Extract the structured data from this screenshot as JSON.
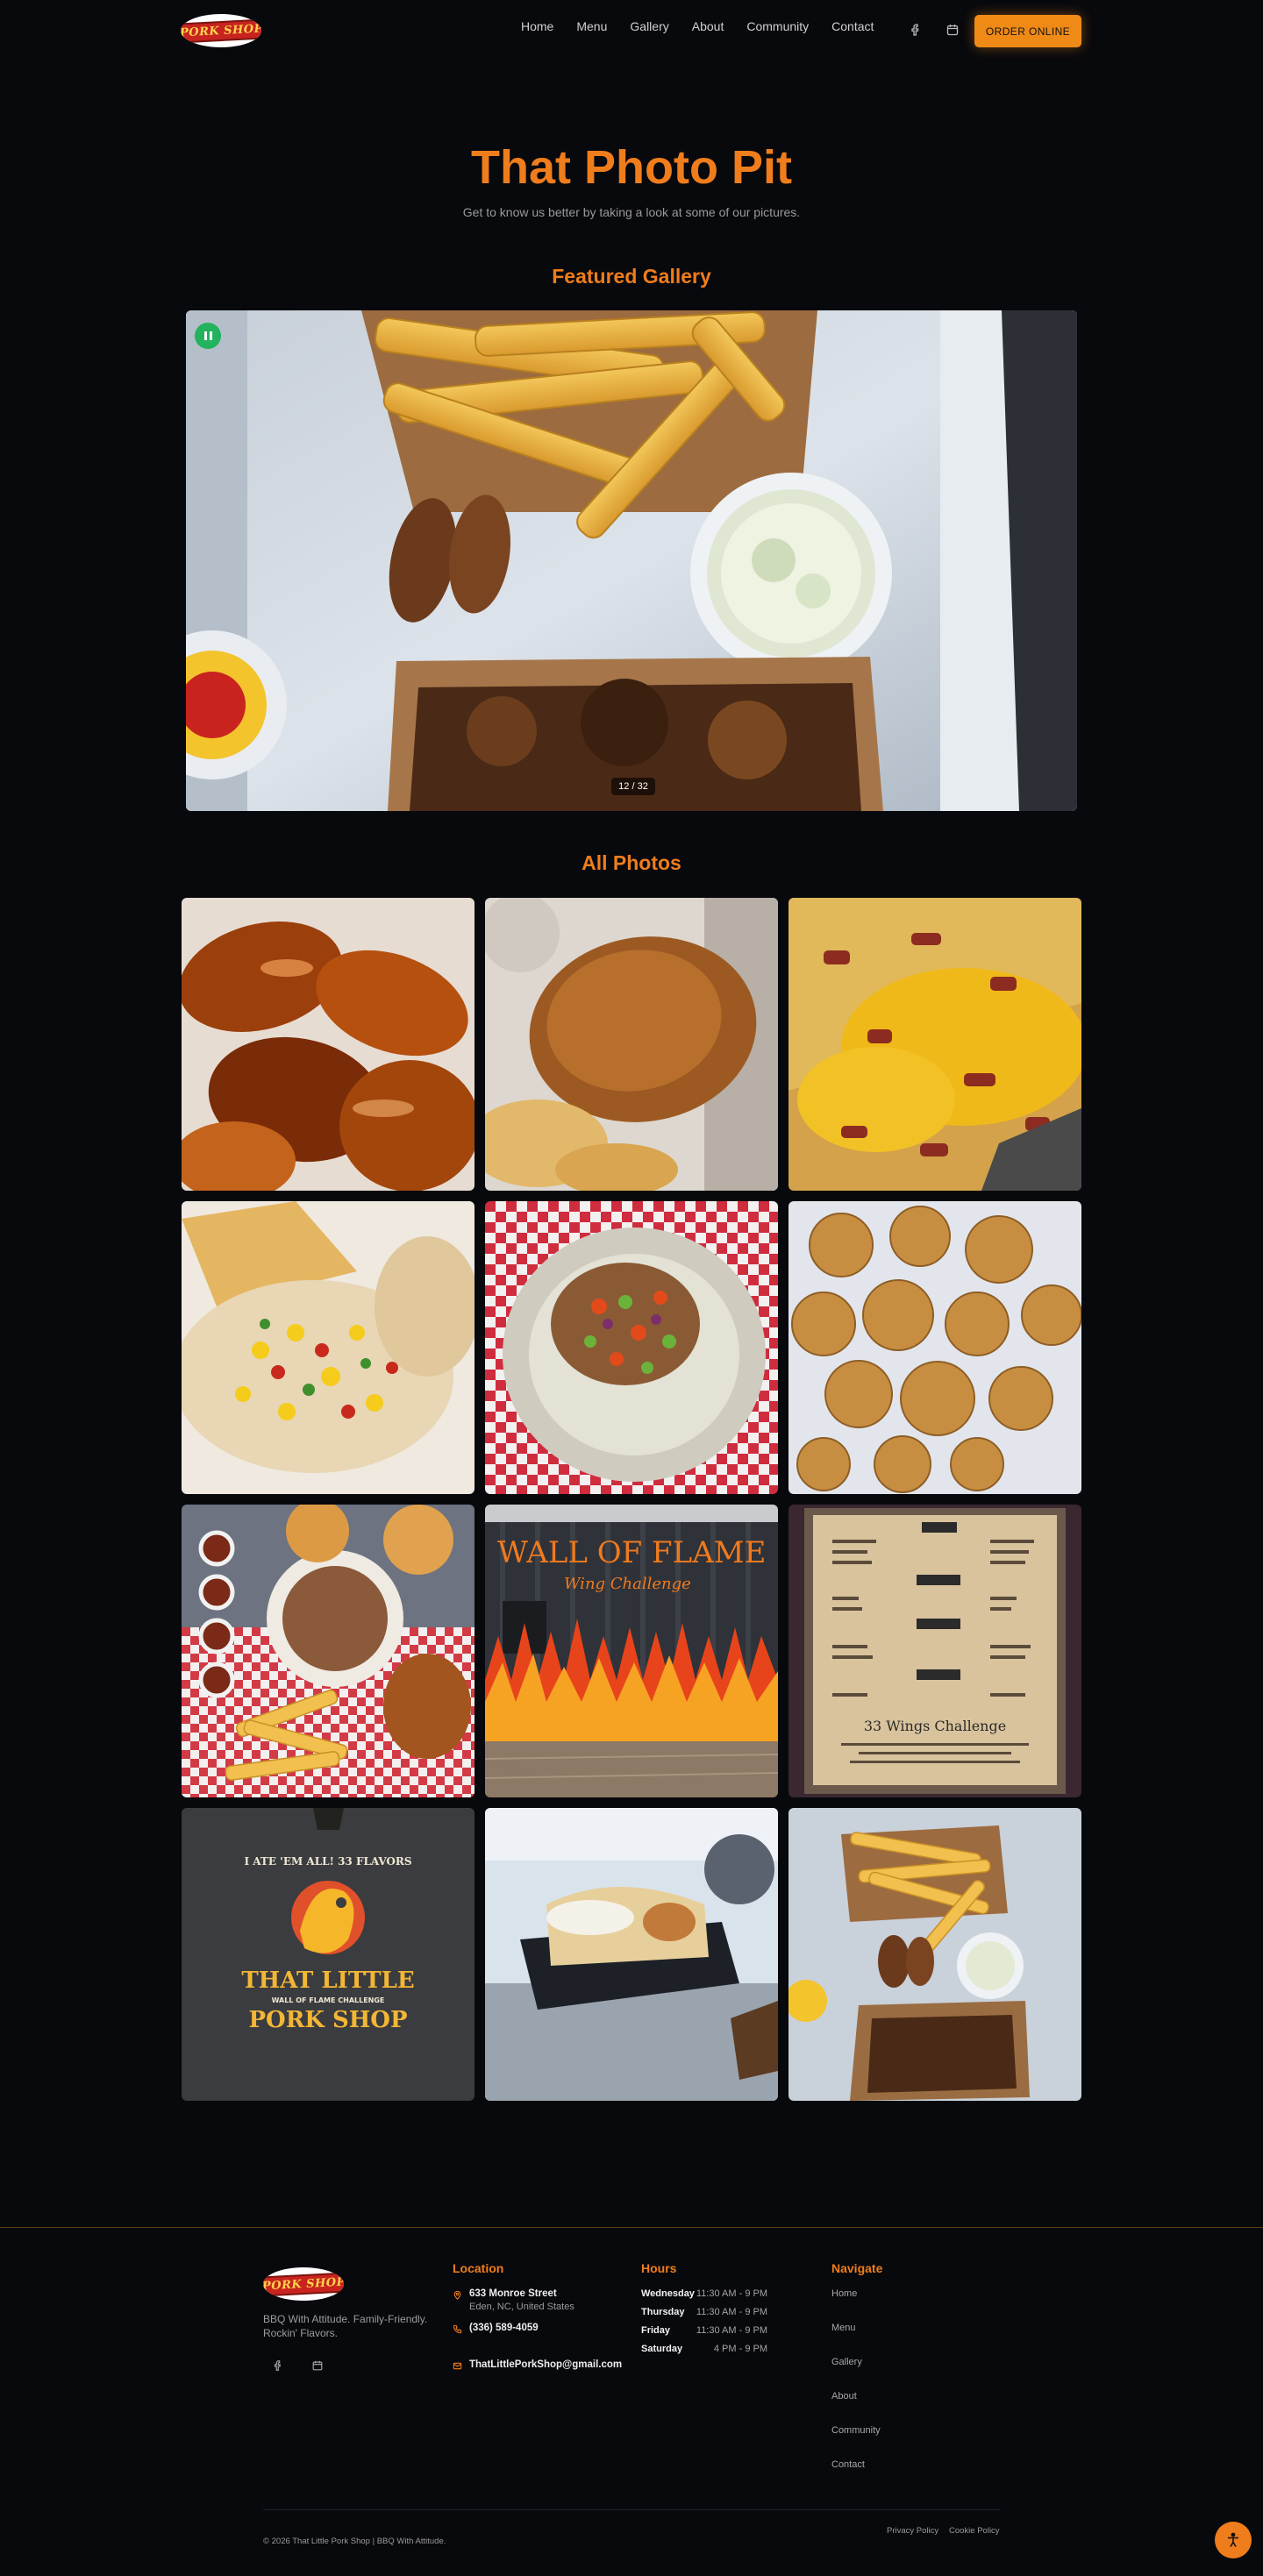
{
  "header": {
    "logo_text": "PORK SHOP",
    "nav": [
      "Home",
      "Menu",
      "Gallery",
      "About",
      "Community",
      "Contact"
    ],
    "icons": [
      "facebook-icon",
      "calendar-icon"
    ],
    "order_button": "ORDER ONLINE"
  },
  "hero": {
    "title": "That Photo Pit",
    "subtitle": "Get to know us better by taking a look at some of our pictures."
  },
  "featured": {
    "heading": "Featured Gallery",
    "counter": "12 / 32",
    "control_icon": "pause-icon"
  },
  "all_photos": {
    "heading": "All Photos",
    "photos": [
      {
        "subject": "glazed chicken wings"
      },
      {
        "subject": "fried pork chop with fries"
      },
      {
        "subject": "loaded cheese bacon fries"
      },
      {
        "subject": "corn salsa tacos"
      },
      {
        "subject": "pulled pork nachos"
      },
      {
        "subject": "fried pickle chips"
      },
      {
        "subject": "bbq platter spread"
      },
      {
        "subject": "wall of flame mural"
      },
      {
        "subject": "33 wings challenge menu board"
      },
      {
        "subject": "challenge t-shirt"
      },
      {
        "subject": "hot dog basket"
      },
      {
        "subject": "fries and pulled pork tray"
      }
    ],
    "overlay_text": {
      "mural_title": "WALL OF FLAME",
      "mural_sub": "Wing Challenge",
      "menu_board_title": "33 Wings Challenge",
      "shirt_top": "I ATE 'EM ALL! 33 FLAVORS",
      "shirt_brand_1": "THAT LITTLE",
      "shirt_sub": "WALL OF FLAME CHALLENGE",
      "shirt_brand_2": "PORK SHOP"
    }
  },
  "footer": {
    "logo_text": "PORK SHOP",
    "tagline": "BBQ With Attitude. Family-Friendly. Rockin' Flavors.",
    "location": {
      "heading": "Location",
      "street": "633 Monroe Street",
      "city": "Eden, NC, United States",
      "phone": "(336) 589-4059",
      "email": "ThatLittlePorkShop@gmail.com"
    },
    "hours": {
      "heading": "Hours",
      "rows": [
        {
          "day": "Wednesday",
          "time": "11:30 AM - 9 PM"
        },
        {
          "day": "Thursday",
          "time": "11:30 AM - 9 PM"
        },
        {
          "day": "Friday",
          "time": "11:30 AM - 9 PM"
        },
        {
          "day": "Saturday",
          "time": "4 PM - 9 PM"
        }
      ]
    },
    "navigate": {
      "heading": "Navigate",
      "links": [
        "Home",
        "Menu",
        "Gallery",
        "About",
        "Community",
        "Contact"
      ]
    },
    "copyright": "© 2026 That Little Pork Shop | BBQ With Attitude.",
    "legal": [
      "Privacy Policy",
      "Cookie Policy"
    ]
  },
  "colors": {
    "accent": "#ef7d1c",
    "background": "#08090d",
    "play_button": "#23b25d"
  }
}
